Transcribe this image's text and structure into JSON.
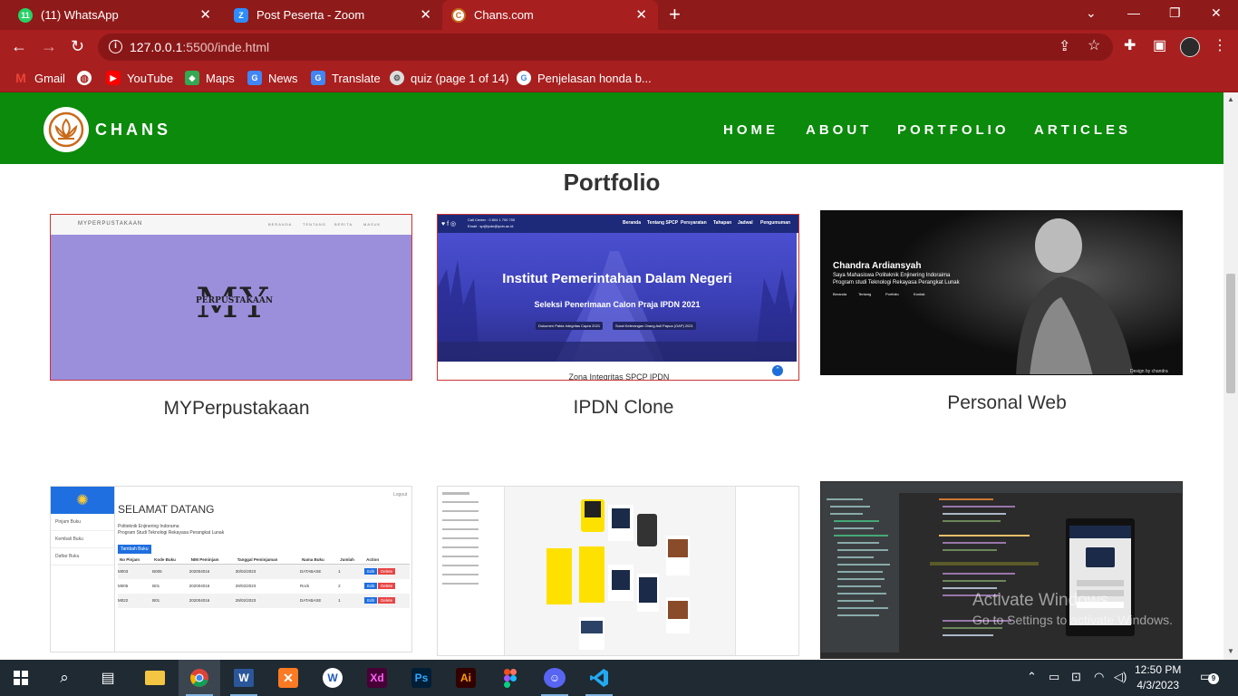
{
  "browser": {
    "tabs": [
      {
        "title": "(11) WhatsApp",
        "badge": "11"
      },
      {
        "title": "Post Peserta - Zoom",
        "badge": "Z"
      },
      {
        "title": "Chans.com",
        "badge": "C"
      }
    ],
    "url_host": "127.0.0.1",
    "url_path": ":5500/inde.html",
    "bookmarks": [
      "Gmail",
      "YouTube",
      "Maps",
      "News",
      "Translate",
      "quiz (page 1 of 14)",
      "Penjelasan honda b..."
    ]
  },
  "site": {
    "brand": "CHANS",
    "menu": [
      "HOME",
      "ABOUT",
      "PORTFOLIO",
      "ARTICLES"
    ],
    "section_title": "Portfolio",
    "projects": [
      {
        "title": "MYPerpustakaan"
      },
      {
        "title": "IPDN Clone"
      },
      {
        "title": "Personal Web"
      }
    ]
  },
  "thumb_myp": {
    "brand": "MYPERPUSTAKAAN",
    "nav": [
      "BERANDA",
      "TENTANG",
      "BERITA",
      "MASUK"
    ],
    "logo_big": "MY",
    "logo_small": "PERPUSTAKAAN"
  },
  "thumb_ipdn": {
    "contact": "Call Center : 0 804 1 700 700",
    "email": "Email : sp@ipdn@ipdn.ac.id",
    "nav": [
      "Beranda",
      "Tentang SPCP",
      "Persyaratan",
      "Tahapan",
      "Jadwal",
      "Pengumuman"
    ],
    "headline": "Institut Pemerintahan Dalam Negeri",
    "sub": "Seleksi Penerimaan Calon Praja IPDN 2021",
    "doc1": "Dokumen Pakta Integritas Capra 2021",
    "doc2": "Surat Keterangan Orang Asli Papua (OAP) 2021",
    "footer": "Zona Integritas SPCP IPDN"
  },
  "thumb_personal": {
    "name": "Chandra Ardiansyah",
    "line1": "Saya Mahasiswa Politeknik Enjinering Indoraima",
    "line2": "Program studi Teknologi Rekayasa Perangkat Lunak",
    "nav": [
      "Beranda",
      "Tentang",
      "Portfolio",
      "Kontak"
    ],
    "credit": "Design by chandra"
  },
  "thumb_admin": {
    "menu": [
      "Pinjam Buku",
      "Kembali Buku",
      "Daftar Buku"
    ],
    "logout": "Logout",
    "title": "SELAMAT DATANG",
    "sub1": "Politeknik Enjinering Indorama",
    "sub2": "Program Studi Teknologi Rekayasa Perangkat Lunak",
    "add_btn": "Tambah Buku",
    "headers": [
      "No Pinjam",
      "Kode Buku",
      "NIM Peminjam",
      "Tanggal Peminjaman",
      "Nama Buku",
      "Jumlah",
      "Action"
    ],
    "rows": [
      [
        "M003",
        "B005",
        "202004016",
        "30/02/2023",
        "DATABASE",
        "1"
      ],
      [
        "M005",
        "B01",
        "202004016",
        "29/02/2023",
        "Rock",
        "2"
      ],
      [
        "M022",
        "B01",
        "202004016",
        "29/02/2023",
        "DATABASE",
        "1"
      ]
    ],
    "edit": "Edit",
    "delete": "Delete"
  },
  "watermark": {
    "line1": "Activate Windows",
    "line2": "Go to Settings to activate Windows."
  },
  "taskbar": {
    "time": "12:50 PM",
    "date": "4/3/2023",
    "notifications": "9"
  }
}
